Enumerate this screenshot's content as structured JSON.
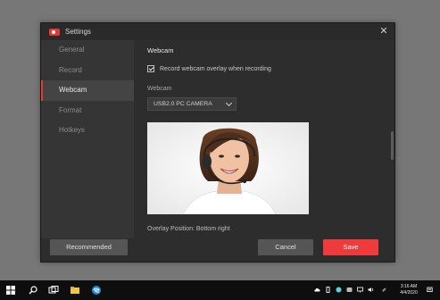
{
  "window": {
    "title": "Settings",
    "close_glyph": "✕"
  },
  "sidebar": {
    "items": [
      {
        "label": "General"
      },
      {
        "label": "Record"
      },
      {
        "label": "Webcam"
      },
      {
        "label": "Format"
      },
      {
        "label": "Hotkeys"
      }
    ],
    "active_index": 2
  },
  "content": {
    "section_title": "Webcam",
    "checkbox_label": "Record webcam overlay when recording",
    "checkbox_checked": true,
    "webcam_label": "Webcam",
    "webcam_value": "USB2.0 PC CAMERA",
    "overlay_position": "Overlay Position: Bottom right"
  },
  "footer": {
    "recommended_label": "Recommended",
    "cancel_label": "Cancel",
    "save_label": "Save"
  },
  "taskbar": {
    "time": "3:16 AM",
    "date": "4/4/2020"
  },
  "colors": {
    "accent": "#ef3b3b",
    "window_bg": "#2d2d2d",
    "sidebar_bg": "#353535",
    "desktop_bg": "#777777",
    "taskbar_bg": "#0e0e0e"
  },
  "icons": {
    "app": "screen-recorder-logo-icon",
    "close": "close-icon",
    "start": "windows-start-icon",
    "search": "search-icon",
    "task_view": "task-view-icon",
    "explorer": "file-explorer-icon",
    "browser": "edge-browser-icon"
  }
}
